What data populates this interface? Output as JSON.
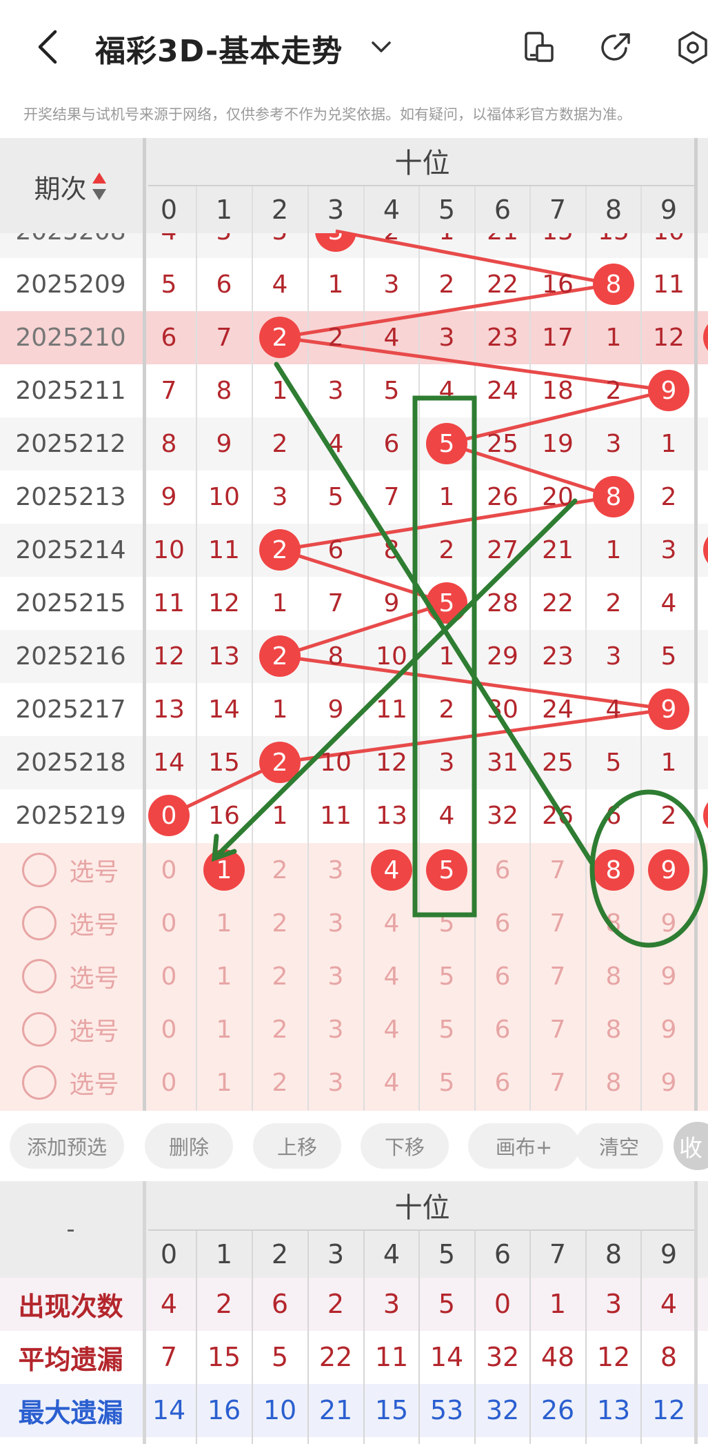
{
  "header": {
    "title": "福彩3D-基本走势",
    "back_icon": "back-arrow-icon",
    "dropdown_icon": "chevron-down-icon",
    "icons": [
      "phone-icon",
      "share-icon",
      "settings-icon"
    ]
  },
  "notice": "开奖结果与试机号来源于网络，仅供参考不作为兑奖依据。如有疑问，以福体彩官方数据为准。",
  "table": {
    "period_header": "期次",
    "group_header": "十位",
    "digits": [
      "0",
      "1",
      "2",
      "3",
      "4",
      "5",
      "6",
      "7",
      "8",
      "9"
    ],
    "partial_row": {
      "period": "2025208",
      "values": [
        "4",
        "5",
        "5",
        "3",
        "2",
        "1",
        "21",
        "15",
        "15",
        "10"
      ],
      "hit": 3
    },
    "rows": [
      {
        "period": "2025209",
        "values": [
          "5",
          "6",
          "4",
          "1",
          "3",
          "2",
          "22",
          "16",
          "8",
          "11"
        ],
        "hit": 8
      },
      {
        "period": "2025210",
        "values": [
          "6",
          "7",
          "2",
          "2",
          "4",
          "3",
          "23",
          "17",
          "1",
          "12"
        ],
        "hit": 2,
        "highlighted": true
      },
      {
        "period": "2025211",
        "values": [
          "7",
          "8",
          "1",
          "3",
          "5",
          "4",
          "24",
          "18",
          "2",
          "9"
        ],
        "hit": 9
      },
      {
        "period": "2025212",
        "values": [
          "8",
          "9",
          "2",
          "4",
          "6",
          "5",
          "25",
          "19",
          "3",
          "1"
        ],
        "hit": 5
      },
      {
        "period": "2025213",
        "values": [
          "9",
          "10",
          "3",
          "5",
          "7",
          "1",
          "26",
          "20",
          "8",
          "2"
        ],
        "hit": 8
      },
      {
        "period": "2025214",
        "values": [
          "10",
          "11",
          "2",
          "6",
          "8",
          "2",
          "27",
          "21",
          "1",
          "3"
        ],
        "hit": 2
      },
      {
        "period": "2025215",
        "values": [
          "11",
          "12",
          "1",
          "7",
          "9",
          "5",
          "28",
          "22",
          "2",
          "4"
        ],
        "hit": 5
      },
      {
        "period": "2025216",
        "values": [
          "12",
          "13",
          "2",
          "8",
          "10",
          "1",
          "29",
          "23",
          "3",
          "5"
        ],
        "hit": 2
      },
      {
        "period": "2025217",
        "values": [
          "13",
          "14",
          "1",
          "9",
          "11",
          "2",
          "30",
          "24",
          "4",
          "9"
        ],
        "hit": 9
      },
      {
        "period": "2025218",
        "values": [
          "14",
          "15",
          "2",
          "10",
          "12",
          "3",
          "31",
          "25",
          "5",
          "1"
        ],
        "hit": 2
      },
      {
        "period": "2025219",
        "values": [
          "0",
          "16",
          "1",
          "11",
          "13",
          "4",
          "32",
          "26",
          "6",
          "2"
        ],
        "hit": 0
      }
    ],
    "select_label": "选号",
    "select_rows": [
      {
        "selected": [
          1,
          4,
          5,
          8,
          9
        ]
      },
      {
        "selected": []
      },
      {
        "selected": []
      },
      {
        "selected": []
      },
      {
        "selected": []
      }
    ]
  },
  "toolbar": {
    "buttons": [
      "添加预选",
      "删除",
      "上移",
      "下移",
      "画布+",
      "清空"
    ],
    "collapse": "收"
  },
  "stats": {
    "corner": "-",
    "group_header": "十位",
    "digits": [
      "0",
      "1",
      "2",
      "3",
      "4",
      "5",
      "6",
      "7",
      "8",
      "9"
    ],
    "rows": [
      {
        "label": "出现次数",
        "values": [
          "4",
          "2",
          "6",
          "2",
          "3",
          "5",
          "0",
          "1",
          "3",
          "4"
        ],
        "color": "#b3262c"
      },
      {
        "label": "平均遗漏",
        "values": [
          "7",
          "15",
          "5",
          "22",
          "11",
          "14",
          "32",
          "48",
          "12",
          "8"
        ],
        "color": "#b3262c"
      },
      {
        "label": "最大遗漏",
        "values": [
          "14",
          "16",
          "10",
          "21",
          "15",
          "53",
          "32",
          "26",
          "13",
          "12"
        ],
        "color": "#2b5fd0"
      }
    ]
  },
  "colors": {
    "hit_ball": "#f04545",
    "trend_line": "#e84a4a",
    "annotation": "#2e7d32",
    "number_text": "#b3262c",
    "select_text": "#e7a5a5",
    "select_bg": "#fdebe7",
    "highlight_row": "#f8d4d4",
    "header_bg": "#ececec"
  }
}
